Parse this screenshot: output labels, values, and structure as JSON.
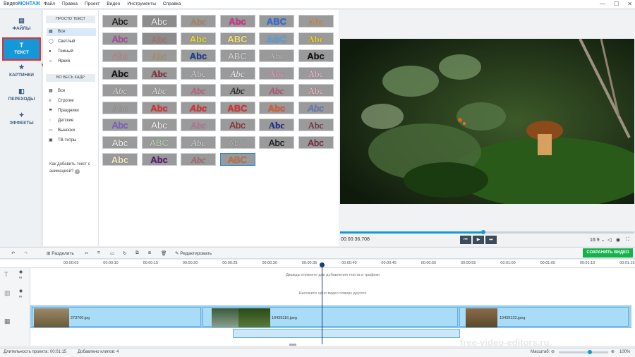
{
  "app": {
    "title_plain": "Видео",
    "title_bold": "МОНТАЖ"
  },
  "menu": [
    "Файл",
    "Правка",
    "Проект",
    "Видео",
    "Инструменты",
    "Справка"
  ],
  "window_controls": [
    "—",
    "☐",
    "✕"
  ],
  "sidebar": [
    {
      "label": "ФАЙЛЫ",
      "icon": "files-icon",
      "glyph": "▤"
    },
    {
      "label": "ТЕКСТ",
      "icon": "text-icon",
      "glyph": "T",
      "active": true
    },
    {
      "label": "КАРТИНКИ",
      "icon": "star-icon",
      "glyph": "★"
    },
    {
      "label": "ПЕРЕХОДЫ",
      "icon": "transitions-icon",
      "glyph": "◧"
    },
    {
      "label": "ЭФФЕКТЫ",
      "icon": "effects-icon",
      "glyph": "✦"
    }
  ],
  "categories": {
    "simple_header": "ПРОСТО ТЕКСТ",
    "simple": [
      {
        "label": "Все",
        "icon": "grid-icon",
        "glyph": "▦",
        "selected": true
      },
      {
        "label": "Светлый",
        "icon": "circle-icon",
        "glyph": "◯"
      },
      {
        "label": "Темный",
        "icon": "dark-circle-icon",
        "glyph": "●"
      },
      {
        "label": "Яркий",
        "icon": "sun-icon",
        "glyph": "☼"
      }
    ],
    "full_header": "ВО ВЕСЬ КАДР",
    "full": [
      {
        "label": "Все",
        "icon": "grid-icon",
        "glyph": "▦"
      },
      {
        "label": "Строгие",
        "icon": "lines-icon",
        "glyph": "≡"
      },
      {
        "label": "Праздники",
        "icon": "gift-icon",
        "glyph": "⚑"
      },
      {
        "label": "Детские",
        "icon": "bubble-icon",
        "glyph": "◌"
      },
      {
        "label": "Выноски",
        "icon": "callout-icon",
        "glyph": "▭"
      },
      {
        "label": "ТВ-титры",
        "icon": "tv-icon",
        "glyph": "▣"
      }
    ],
    "help": "Как добавить текст с анимацией?"
  },
  "text_styles": [
    {
      "t": "Abc",
      "c": "#111",
      "b": "#9a9a9a",
      "f": "sans"
    },
    {
      "t": "Abc",
      "c": "#f4f4f4",
      "b": "#8c8c8c",
      "f": "sans"
    },
    {
      "t": "Abc",
      "c": "#c78a4a",
      "b": "#9a9a9a",
      "f": "serif"
    },
    {
      "t": "Abc",
      "c": "#e02a8a",
      "b": "#9a9a9a",
      "f": "sans",
      "w": "bold"
    },
    {
      "t": "ABC",
      "c": "#2b6ee8",
      "b": "#9a9a9a",
      "f": "sans",
      "w": "bold"
    },
    {
      "t": "Abc",
      "c": "#e89a3a",
      "b": "#9a9a9a",
      "f": "serif"
    },
    {
      "t": "Abc",
      "c": "#c03ab0",
      "b": "#9a9a9a",
      "f": "sans"
    },
    {
      "t": "Abc",
      "c": "#c77",
      "b": "#8c8c8c",
      "f": "serif"
    },
    {
      "t": "Abc",
      "c": "#e6d63a",
      "b": "#9a9a9a",
      "f": "sans",
      "w": "bold"
    },
    {
      "t": "ABC",
      "c": "#f5e07a",
      "b": "#9a9a9a",
      "f": "sans",
      "w": "bold"
    },
    {
      "t": "ABC",
      "c": "#5aa8f0",
      "b": "#9a9a9a",
      "f": "sans",
      "w": "bold"
    },
    {
      "t": "Abc",
      "c": "#e8d02a",
      "b": "#9a9a9a",
      "f": "serif",
      "w": "bold"
    },
    {
      "t": "Abc",
      "c": "#d49090",
      "b": "#9a9a9a",
      "f": "sans"
    },
    {
      "t": "Abc",
      "c": "#c9a060",
      "b": "#9a9a9a",
      "f": "serif"
    },
    {
      "t": "Abc",
      "c": "#1a3a9a",
      "b": "#9a9a9a",
      "f": "sans",
      "w": "bold"
    },
    {
      "t": "ABC",
      "c": "#d8d8d8",
      "b": "#9a9a9a",
      "f": "sans"
    },
    {
      "t": "Abc",
      "c": "#c0c0c0",
      "b": "#9a9a9a",
      "f": "serif"
    },
    {
      "t": "Abc",
      "c": "#111",
      "b": "#9a9a9a",
      "f": "sans",
      "w": "bold"
    },
    {
      "t": "Abc",
      "c": "#111",
      "b": "#9a9a9a",
      "f": "sans",
      "w": "bold"
    },
    {
      "t": "Abc",
      "c": "#8a2a3a",
      "b": "#9a9a9a",
      "f": "serif",
      "w": "bold"
    },
    {
      "t": "Abc",
      "c": "#d0d0d0",
      "b": "#9a9a9a",
      "f": "serif"
    },
    {
      "t": "Abc",
      "c": "#f2f2f2",
      "b": "#9a9a9a",
      "f": "serif",
      "i": true
    },
    {
      "t": "Abc",
      "c": "#f0a0c0",
      "b": "#9a9a9a",
      "f": "serif"
    },
    {
      "t": "Abc",
      "c": "#f0c0d0",
      "b": "#9a9a9a",
      "f": "serif"
    },
    {
      "t": "Abc",
      "c": "#d8d8d8",
      "b": "#9a9a9a",
      "f": "serif",
      "i": true
    },
    {
      "t": "Abc",
      "c": "#e0e0e0",
      "b": "#9a9a9a",
      "f": "serif",
      "i": true
    },
    {
      "t": "Abc",
      "c": "#e05a8a",
      "b": "#9a9a9a",
      "f": "serif",
      "i": true
    },
    {
      "t": "Abc",
      "c": "#222",
      "b": "#9a9a9a",
      "f": "serif",
      "i": true
    },
    {
      "t": "Abc",
      "c": "#d04a7a",
      "b": "#9a9a9a",
      "f": "serif",
      "i": true
    },
    {
      "t": "Abc",
      "c": "#f3c0c8",
      "b": "#9a9a9a",
      "f": "serif"
    },
    {
      "t": "Abc",
      "c": "#a8a8a8",
      "b": "#9a9a9a",
      "f": "serif"
    },
    {
      "t": "Abc",
      "c": "#e62a2a",
      "b": "#9a9a9a",
      "f": "sans",
      "w": "bold"
    },
    {
      "t": "Abc",
      "c": "#e62a2a",
      "b": "#9a9a9a",
      "f": "sans",
      "w": "bold",
      "i": true
    },
    {
      "t": "ABC",
      "c": "#e62a2a",
      "b": "#9a9a9a",
      "f": "sans",
      "w": "bold"
    },
    {
      "t": "Abc",
      "c": "#e85a2a",
      "b": "#9a9a9a",
      "f": "sans",
      "w": "bold"
    },
    {
      "t": "Abc",
      "c": "#5a7ad8",
      "b": "#9a9a9a",
      "f": "sans",
      "i": true
    },
    {
      "t": "Abc",
      "c": "#7a5ae0",
      "b": "#9a9a9a",
      "f": "sans"
    },
    {
      "t": "Abc",
      "c": "#f4f4f4",
      "b": "#9a9a9a",
      "f": "sans"
    },
    {
      "t": "Abc",
      "c": "#e0709a",
      "b": "#9a9a9a",
      "f": "serif"
    },
    {
      "t": "Abc",
      "c": "#9a2a2a",
      "b": "#9a9a9a",
      "f": "sans"
    },
    {
      "t": "Abc",
      "c": "#1a2a9a",
      "b": "#9a9a9a",
      "f": "serif",
      "w": "bold"
    },
    {
      "t": "Abc",
      "c": "#7a2a3a",
      "b": "#9a9a9a",
      "f": "serif"
    },
    {
      "t": "Abc",
      "c": "#f4f4f4",
      "b": "#9a9a9a",
      "f": "sans"
    },
    {
      "t": "ABC",
      "c": "#c0d8c0",
      "b": "#9a9a9a",
      "f": "sans"
    },
    {
      "t": "Abc",
      "c": "#d8d8d8",
      "b": "#9a9a9a",
      "f": "serif",
      "i": true
    },
    {
      "t": "ABC",
      "c": "#b0b0b0",
      "b": "#9a9a9a",
      "f": "sans"
    },
    {
      "t": "Abc",
      "c": "#111",
      "b": "#9a9a9a",
      "f": "sans"
    },
    {
      "t": "Abc",
      "c": "#7a1a2a",
      "b": "#9a9a9a",
      "f": "sans"
    },
    {
      "t": "Abc",
      "c": "#f4e8c8",
      "b": "#9a9a9a",
      "f": "sans",
      "w": "bold"
    },
    {
      "t": "Abc",
      "c": "#5a1a7a",
      "b": "#9a9a9a",
      "f": "sans",
      "w": "bold"
    },
    {
      "t": "Abc",
      "c": "#c06070",
      "b": "#9a9a9a",
      "f": "serif",
      "i": true
    },
    {
      "t": "ABC",
      "c": "#d86a2a",
      "b": "#9a9a9a",
      "f": "sans",
      "sel": true
    }
  ],
  "player": {
    "time": "00:00:36.708",
    "aspect": "16:9 ⌄",
    "progress": 0.49
  },
  "player_buttons": [
    "⏮",
    "▶",
    "⏭"
  ],
  "toolbar": {
    "split": "Разделить",
    "edit": "Редактировать",
    "save": "СОХРАНИТЬ ВИДЕО"
  },
  "ruler": [
    "00:00:05",
    "00:00:10",
    "00:00:15",
    "00:00:20",
    "00:00:25",
    "00:00:30",
    "00:00:35",
    "00:00:40",
    "00:00:45",
    "00:00:50",
    "00:00:55",
    "00:01:00",
    "00:01:05",
    "00:01:10",
    "00:01:15"
  ],
  "hints": {
    "text": "Дважды кликните для добавления текста и графики",
    "overlay": "Наложите одно видео поверх другого"
  },
  "clips": [
    {
      "name": "273760.jpg"
    },
    {
      "name": "10439116.jpeg"
    },
    {
      "name": "10439123.jpeg"
    }
  ],
  "status": {
    "duration_label": "Длительность проекта:",
    "duration": "00:01:15",
    "added_label": "Добавлено клипов:",
    "added": "4",
    "scale_label": "Масштаб:",
    "zoom": "100%"
  },
  "watermark": "free-video-editors.ru"
}
